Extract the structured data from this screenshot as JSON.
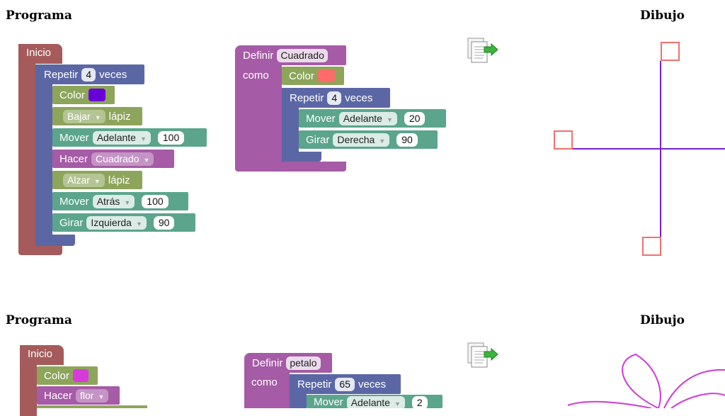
{
  "section1": {
    "programa_heading": "Programa",
    "dibujo_heading": "Dibujo",
    "main": {
      "inicio": "Inicio",
      "repetir": {
        "label": "Repetir",
        "count": "4",
        "suffix": "veces"
      },
      "color": {
        "label": "Color",
        "value": "#6a00d8"
      },
      "bajar": {
        "value": "Bajar",
        "suffix": "lápiz"
      },
      "mover1": {
        "label": "Mover",
        "dir": "Adelante",
        "amount": "100"
      },
      "hacer": {
        "label": "Hacer",
        "value": "Cuadrado"
      },
      "alzar": {
        "value": "Alzar",
        "suffix": "lápiz"
      },
      "mover2": {
        "label": "Mover",
        "dir": "Atrás",
        "amount": "100"
      },
      "girar": {
        "label": "Girar",
        "dir": "Izquierda",
        "amount": "90"
      }
    },
    "def": {
      "definir": "Definir",
      "name": "Cuadrado",
      "como": "como",
      "color": {
        "label": "Color",
        "value": "#ff6b6b"
      },
      "repetir": {
        "label": "Repetir",
        "count": "4",
        "suffix": "veces"
      },
      "mover": {
        "label": "Mover",
        "dir": "Adelante",
        "amount": "20"
      },
      "girar": {
        "label": "Girar",
        "dir": "Derecha",
        "amount": "90"
      }
    }
  },
  "section2": {
    "programa_heading": "Programa",
    "dibujo_heading": "Dibujo",
    "main": {
      "inicio": "Inicio",
      "color": {
        "label": "Color",
        "value": "#d63adb"
      },
      "hacer": {
        "label": "Hacer",
        "value": "flor"
      }
    },
    "def": {
      "definir": "Definir",
      "name": "petalo",
      "como": "como",
      "repetir": {
        "label": "Repetir",
        "count": "65",
        "suffix": "veces"
      },
      "mover": {
        "label": "Mover",
        "dir": "Adelante",
        "amount": "2"
      }
    }
  },
  "colors": {
    "drawing_line": "#7a1fd0",
    "drawing_square": "#f07070",
    "flower": "#d03ad6"
  },
  "icons": {
    "copy": "document-arrow-icon"
  }
}
